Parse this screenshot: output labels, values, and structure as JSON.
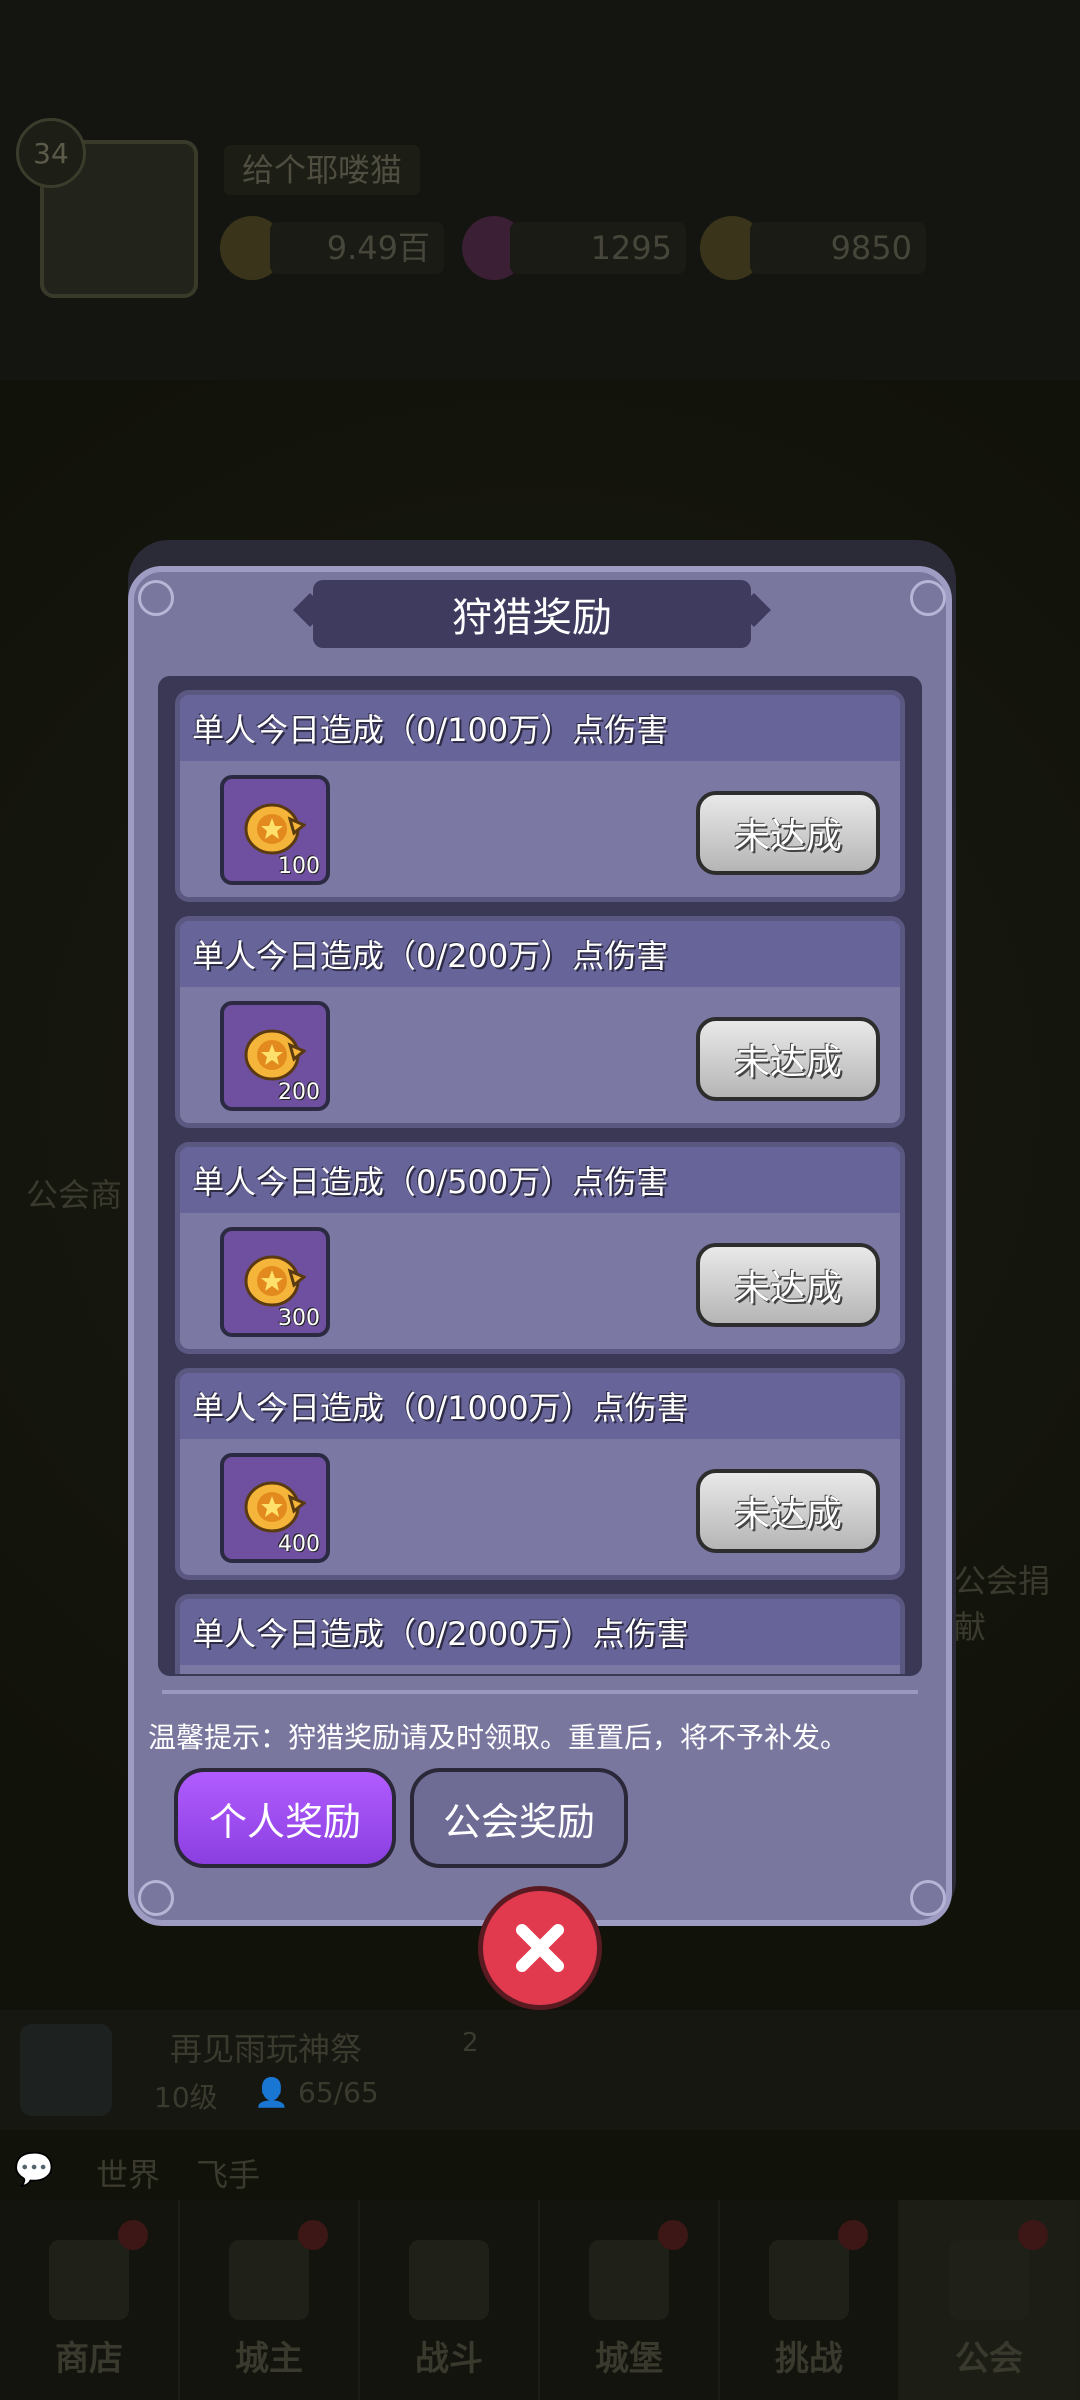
{
  "background": {
    "player_level": "34",
    "player_name": "给个耶喽猫",
    "resources": [
      {
        "icon": "gold-coin-plus-icon",
        "value": "9.49百"
      },
      {
        "icon": "potion-plus-icon",
        "value": "1295"
      },
      {
        "icon": "gem-plus-icon",
        "value": "9850"
      }
    ],
    "side_text_left": "公会商",
    "side_text_right": "公会捐献",
    "guild_name": "再见雨玩神祭",
    "guild_level": "10级",
    "guild_members": "65/65",
    "guild_badge_count": "2",
    "chat_channel": "世界",
    "chat_text": "飞手",
    "nav": [
      {
        "label": "商店",
        "icon": "shop-icon"
      },
      {
        "label": "城主",
        "icon": "crown-icon"
      },
      {
        "label": "战斗",
        "icon": "swords-icon"
      },
      {
        "label": "城堡",
        "icon": "castle-icon"
      },
      {
        "label": "挑战",
        "icon": "challenge-icon"
      },
      {
        "label": "公会",
        "icon": "guild-icon"
      }
    ]
  },
  "dialog": {
    "title": "狩猎奖励",
    "rewards": [
      {
        "title": "单人今日造成（0/100万）点伤害",
        "qty": "100",
        "status": "未达成"
      },
      {
        "title": "单人今日造成（0/200万）点伤害",
        "qty": "200",
        "status": "未达成"
      },
      {
        "title": "单人今日造成（0/500万）点伤害",
        "qty": "300",
        "status": "未达成"
      },
      {
        "title": "单人今日造成（0/1000万）点伤害",
        "qty": "400",
        "status": "未达成"
      },
      {
        "title": "单人今日造成（0/2000万）点伤害",
        "qty": "",
        "status": ""
      }
    ],
    "tip": "温馨提示：狩猎奖励请及时领取。重置后，将不予补发。",
    "tabs": {
      "personal": "个人奖励",
      "guild": "公会奖励"
    },
    "close_icon": "close-icon"
  },
  "colors": {
    "dialog_bg": "#7a779f",
    "active_tab": "#9b4cf0",
    "close_button": "#e13a4e",
    "disabled_button": "#c9c9c9"
  }
}
